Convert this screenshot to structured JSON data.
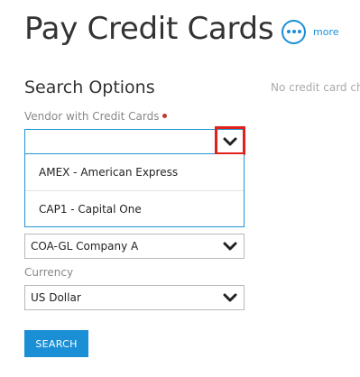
{
  "header": {
    "title": "Pay Credit Cards",
    "more_label": "more",
    "more_icon": "ellipsis-icon",
    "accent_color": "#1a8fd6"
  },
  "search_options": {
    "heading": "Search Options",
    "side_note": "No credit card cha",
    "vendor": {
      "label": "Vendor with Credit Cards",
      "required": true,
      "value": "",
      "is_open": true,
      "options": [
        "AMEX - American Express",
        "CAP1 - Capital One"
      ]
    },
    "company": {
      "value": "COA-GL Company A"
    },
    "currency": {
      "label": "Currency",
      "value": "US Dollar"
    },
    "search_button": "SEARCH"
  },
  "highlight_color": "#e0201b"
}
